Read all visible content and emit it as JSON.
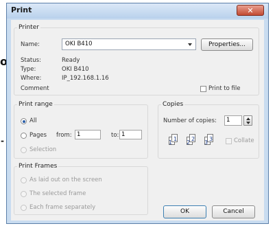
{
  "dialog": {
    "title": "Print",
    "close_glyph": "✕"
  },
  "printer": {
    "legend": "Printer",
    "name_label": "Name:",
    "name_value": "OKI B410",
    "properties_label": "Properties...",
    "status_label": "Status:",
    "status_value": "Ready",
    "type_label": "Type:",
    "type_value": "OKI B410",
    "where_label": "Where:",
    "where_value": "IP_192.168.1.16",
    "comment_label": "Comment",
    "print_to_file_label": "Print to file"
  },
  "print_range": {
    "legend": "Print range",
    "all_label": "All",
    "pages_label": "Pages",
    "from_label": "from:",
    "from_value": "1",
    "to_label": "to:",
    "to_value": "1",
    "selection_label": "Selection"
  },
  "copies": {
    "legend": "Copies",
    "number_label": "Number of copies:",
    "number_value": "1",
    "collate_label": "Collate",
    "collate_icons": [
      "1",
      "1",
      "2",
      "2",
      "3",
      "3"
    ]
  },
  "print_frames": {
    "legend": "Print Frames",
    "as_laid_out_label": "As laid out on the screen",
    "selected_frame_label": "The selected frame",
    "each_frame_label": "Each frame separately"
  },
  "buttons": {
    "ok_label": "OK",
    "cancel_label": "Cancel"
  },
  "background": {
    "left_glyph": "o",
    "left_glyph2": "-"
  }
}
